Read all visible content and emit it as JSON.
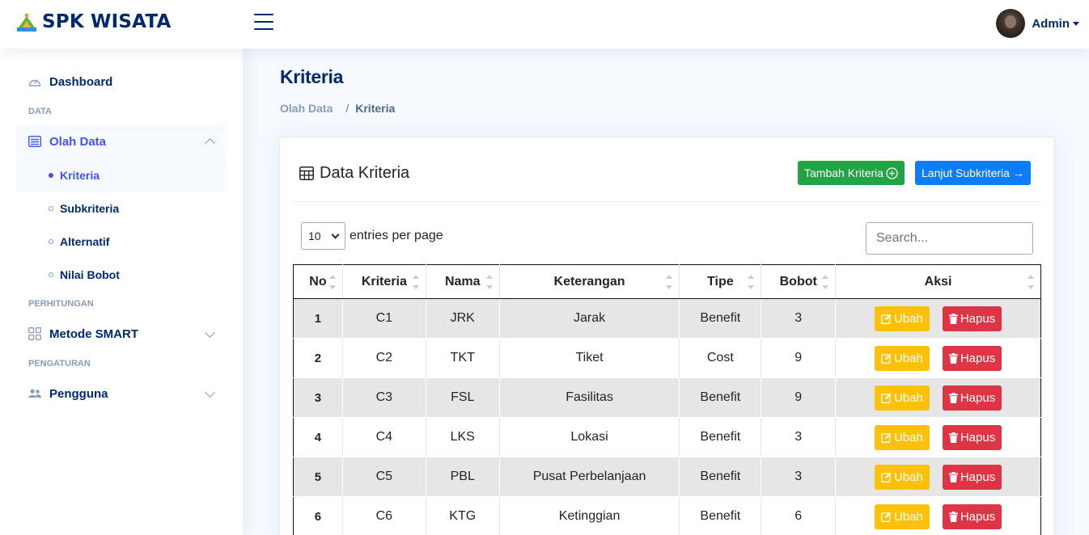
{
  "app": {
    "title": "SPK WISATA"
  },
  "header": {
    "profile_name": "Admin"
  },
  "sidebar": {
    "dashboard": "Dashboard",
    "heading_data": "DATA",
    "olah_data": "Olah Data",
    "sub_items": [
      "Kriteria",
      "Subkriteria",
      "Alternatif",
      "Nilai Bobot"
    ],
    "heading_perhitungan": "PERHITUNGAN",
    "metode": "Metode SMART",
    "heading_pengaturan": "PENGATURAN",
    "pengguna": "Pengguna"
  },
  "page": {
    "title": "Kriteria",
    "breadcrumb": [
      "Olah Data",
      "/",
      "Kriteria"
    ]
  },
  "card": {
    "title": "Data Kriteria",
    "add_button": "Tambah Kriteria",
    "next_button": "Lanjut Subkriteria →",
    "entries_value": "10",
    "entries_label": "entries per page",
    "search_placeholder": "Search..."
  },
  "table": {
    "headers": [
      "No",
      "Kriteria",
      "Nama",
      "Keterangan",
      "Tipe",
      "Bobot",
      "Aksi"
    ],
    "edit_label": "Ubah",
    "delete_label": "Hapus",
    "rows": [
      [
        "1",
        "C1",
        "JRK",
        "Jarak",
        "Benefit",
        "3"
      ],
      [
        "2",
        "C2",
        "TKT",
        "Tiket",
        "Cost",
        "9"
      ],
      [
        "3",
        "C3",
        "FSL",
        "Fasilitas",
        "Benefit",
        "9"
      ],
      [
        "4",
        "C4",
        "LKS",
        "Lokasi",
        "Benefit",
        "3"
      ],
      [
        "5",
        "C5",
        "PBL",
        "Pusat Perbelanjaan",
        "Benefit",
        "3"
      ],
      [
        "6",
        "C6",
        "KTG",
        "Ketinggian",
        "Benefit",
        "6"
      ]
    ]
  },
  "colors": {
    "brand": "#012970",
    "accent": "#4154f1",
    "success": "#22a344",
    "primary": "#0d7cf5",
    "warning": "#ffc107",
    "danger": "#dc3545"
  }
}
